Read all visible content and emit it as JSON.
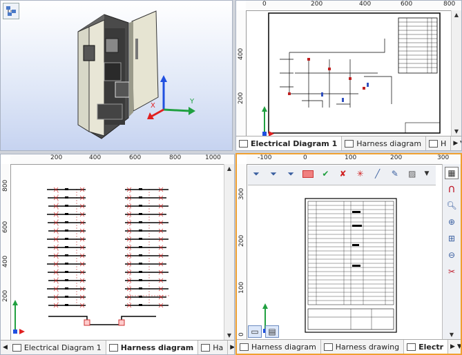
{
  "pane_3d": {
    "toolbar_icon": "model-tree-icon",
    "axis_x": "X",
    "axis_y": "Y"
  },
  "pane_schematic": {
    "ruler_h": [
      "0",
      "200",
      "400",
      "600",
      "800"
    ],
    "ruler_v": [
      "400",
      "200"
    ],
    "tabs": [
      {
        "label": "Electrical Diagram 1",
        "active": true
      },
      {
        "label": "Harness diagram",
        "active": false
      },
      {
        "label": "H",
        "active": false
      }
    ]
  },
  "pane_harness": {
    "ruler_h": [
      "200",
      "400",
      "600",
      "800",
      "1000"
    ],
    "ruler_v": [
      "800",
      "600",
      "400",
      "200"
    ],
    "tabs": [
      {
        "label": "Electrical Diagram 1",
        "active": false
      },
      {
        "label": "Harness diagram",
        "active": true
      },
      {
        "label": "Ha",
        "active": false
      }
    ]
  },
  "pane_drawing": {
    "ruler_h": [
      "-100",
      "0",
      "100",
      "200",
      "300"
    ],
    "ruler_v": [
      "300",
      "200",
      "100",
      "0"
    ],
    "tabs": [
      {
        "label": "Harness diagram",
        "active": false
      },
      {
        "label": "Harness drawing",
        "active": false
      },
      {
        "label": "Electr",
        "active": true
      }
    ]
  },
  "colors": {
    "accent": "#f0a030",
    "axis_x": "#e02020",
    "axis_y": "#20a040",
    "axis_z": "#2050e0"
  }
}
